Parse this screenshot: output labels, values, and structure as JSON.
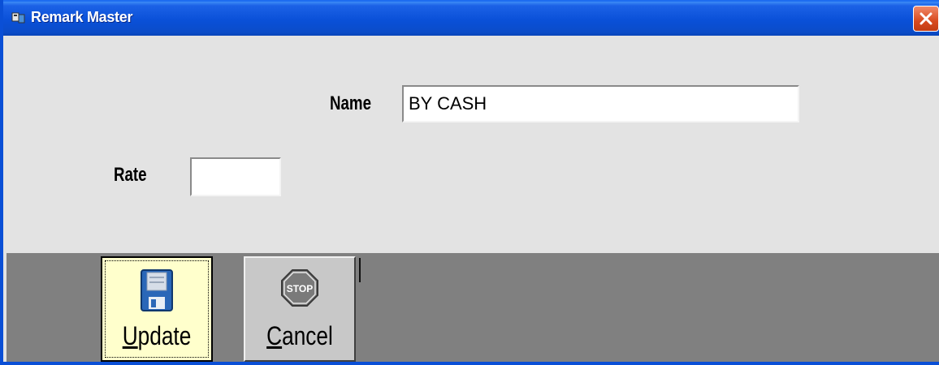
{
  "window": {
    "title": "Remark Master",
    "close_label": "X",
    "title_color": "#0a50d8"
  },
  "form": {
    "name_label": "Name",
    "name_value": "BY CASH",
    "rate_label": "Rate",
    "rate_value": ""
  },
  "toolbar": {
    "update_label_accel": "U",
    "update_label_rest": "pdate",
    "cancel_label_accel": "C",
    "cancel_label_rest": "ancel",
    "update_icon": "floppy-disk-icon",
    "cancel_icon": "stop-sign-icon"
  }
}
